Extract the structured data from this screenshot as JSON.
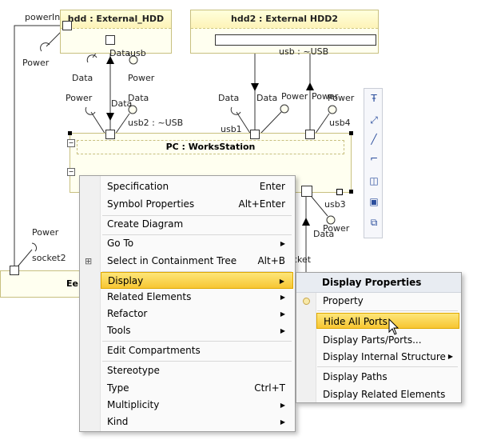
{
  "diagram": {
    "hdd_title": "hdd : External_HDD",
    "hdd2_title": "hdd2 : External HDD2",
    "pc_title": "PC : WorksStation",
    "partial_left_title": "Ee",
    "labels": {
      "powerIn": "powerIn",
      "power_left_top": "Power",
      "data_hdd": "Data",
      "usb_hdd": "usb",
      "data_hdd_left": "Data",
      "power_hdd": "Power",
      "power_pc1": "Power",
      "data_mid": "Data",
      "data_pc1": "Data",
      "usb2": "usb2 : ~USB",
      "usb_hdd2": "usb : ~USB",
      "data_usb1": "Data",
      "data_usb1b": "Data",
      "usb1": "usb1",
      "power_usb1": "Power",
      "power_usb4a": "Power",
      "power_usb4b": "Power",
      "usb4": "usb4",
      "usb3": "usb3",
      "power_usb3": "Power",
      "data_usb3": "Data",
      "power_socket": "Power",
      "socket2": "socket2",
      "socket_partial": "cket"
    }
  },
  "context_menu": {
    "items": [
      {
        "label": "Specification",
        "shortcut": "Enter"
      },
      {
        "label": "Symbol Properties",
        "shortcut": "Alt+Enter"
      },
      {
        "label": "Create Diagram",
        "shortcut": ""
      },
      {
        "label": "Go To",
        "shortcut": ""
      },
      {
        "label": "Select in Containment Tree",
        "shortcut": "Alt+B"
      },
      {
        "label": "Display",
        "shortcut": ""
      },
      {
        "label": "Related Elements",
        "shortcut": ""
      },
      {
        "label": "Refactor",
        "shortcut": ""
      },
      {
        "label": "Tools",
        "shortcut": ""
      },
      {
        "label": "Edit Compartments",
        "shortcut": ""
      },
      {
        "label": "Stereotype",
        "shortcut": ""
      },
      {
        "label": "Type",
        "shortcut": "Ctrl+T"
      },
      {
        "label": "Multiplicity",
        "shortcut": ""
      },
      {
        "label": "Kind",
        "shortcut": ""
      }
    ]
  },
  "submenu": {
    "header": "Display Properties",
    "items": [
      {
        "label": "Property"
      },
      {
        "label": "Hide All Ports"
      },
      {
        "label": "Display Parts/Ports..."
      },
      {
        "label": "Display Internal Structure"
      },
      {
        "label": "Display Paths"
      },
      {
        "label": "Display Related Elements"
      }
    ]
  },
  "icons": {
    "toolbar": [
      "text-format-icon",
      "connector-icon",
      "line-icon",
      "note-icon",
      "part-icon",
      "display-icon",
      "layout-icon"
    ]
  },
  "colors": {
    "highlight": "#f7c632",
    "part_fill": "#fffff0",
    "toolbar_icon": "#2a4d9c"
  }
}
